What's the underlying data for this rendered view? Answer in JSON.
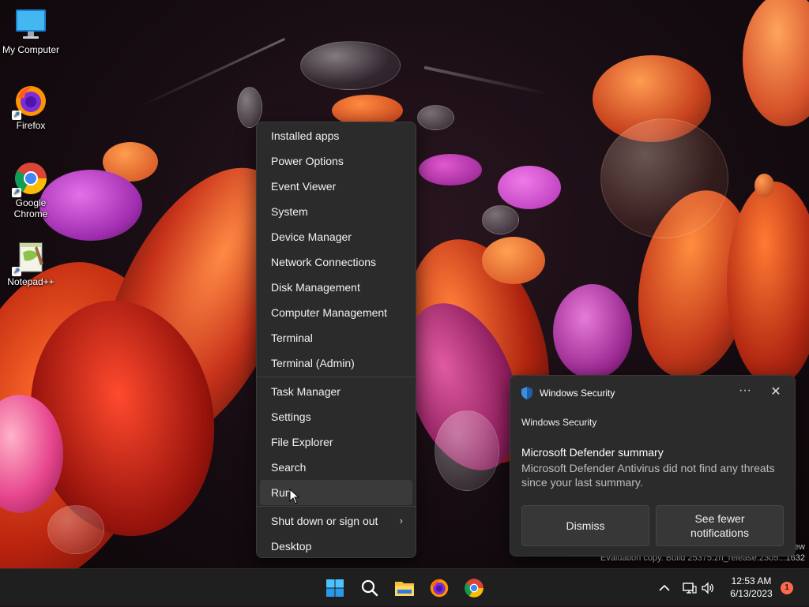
{
  "desktop": {
    "icons": [
      {
        "label": "My Computer",
        "icon": "monitor-icon"
      },
      {
        "label": "Firefox",
        "icon": "firefox-icon"
      },
      {
        "label": "Google\nChrome",
        "icon": "chrome-icon"
      },
      {
        "label": "Notepad++",
        "icon": "notepadpp-icon"
      }
    ]
  },
  "context_menu": {
    "items": [
      "Installed apps",
      "Power Options",
      "Event Viewer",
      "System",
      "Device Manager",
      "Network Connections",
      "Disk Management",
      "Computer Management",
      "Terminal",
      "Terminal (Admin)",
      "Task Manager",
      "Settings",
      "File Explorer",
      "Search",
      "Run",
      "Shut down or sign out",
      "Desktop"
    ],
    "hovered": "Run",
    "submenu_chevron": "›"
  },
  "toast": {
    "header": "Windows Security",
    "more": "···",
    "close": "✕",
    "app_name": "Windows Security",
    "title": "Microsoft Defender summary",
    "body": "Microsoft Defender Antivirus did not find any threats since your last summary.",
    "buttons": [
      "Dismiss",
      "See fewer notifications"
    ]
  },
  "watermark": {
    "line1": "ew",
    "line2": "Evaluation copy. Build 25375.zn_release.2305...1632"
  },
  "taskbar": {
    "apps": [
      "start-icon",
      "search-icon",
      "file-explorer-icon",
      "firefox-icon",
      "chrome-icon"
    ],
    "time": "12:53 AM",
    "date": "6/13/2023",
    "notification_count": "1"
  },
  "colors": {
    "menu_bg": "#2b2b2b",
    "taskbar_bg": "#1f1f1f",
    "accent": "#0078d4",
    "badge": "#ff6a4d"
  }
}
